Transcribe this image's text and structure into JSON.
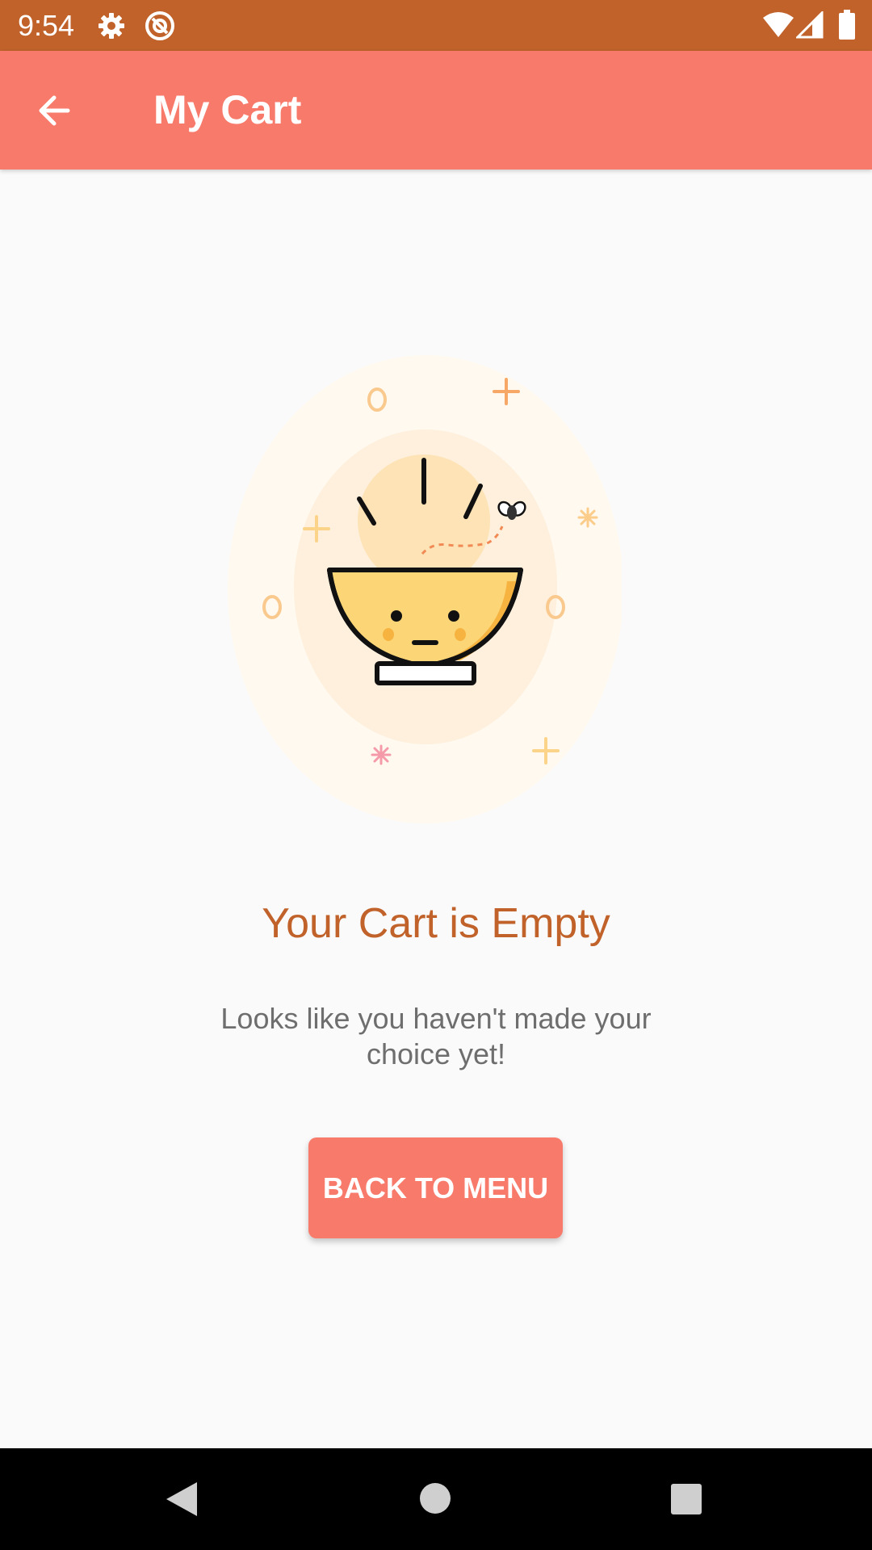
{
  "status_bar": {
    "time": "9:54",
    "icons": [
      "settings-gear-icon",
      "at-sign-icon",
      "wifi-icon",
      "cell-signal-icon",
      "battery-icon"
    ],
    "background": "#C0622A"
  },
  "app_bar": {
    "title": "My Cart",
    "back_icon": "arrow-back-icon",
    "background": "#F87A6B"
  },
  "empty_state": {
    "illustration": "empty-bowl-illustration",
    "title": "Your Cart is Empty",
    "message": "Looks like you haven't made your choice yet!",
    "title_color": "#C0622A"
  },
  "cta": {
    "label": "BACK TO MENU",
    "color": "#F87A6B"
  },
  "nav_bar": {
    "buttons": [
      "back-triangle-icon",
      "home-circle-icon",
      "recents-square-icon"
    ]
  }
}
